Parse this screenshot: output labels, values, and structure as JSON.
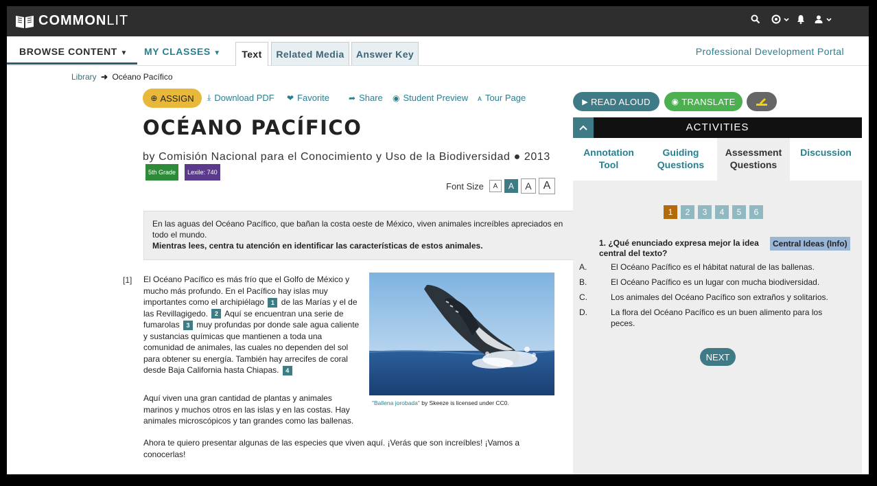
{
  "brand": {
    "part1": "COMMON",
    "part2": "LIT"
  },
  "nav": {
    "browse_content": "BROWSE CONTENT",
    "my_classes": "MY CLASSES",
    "tabs": [
      "Text",
      "Related Media",
      "Answer Key"
    ],
    "pd_portal": "Professional Development Portal"
  },
  "breadcrumb": {
    "library": "Library",
    "current": "Océano Pacífico"
  },
  "actions": {
    "assign": "ASSIGN",
    "download_pdf": "Download PDF",
    "favorite": "Favorite",
    "share": "Share",
    "student_preview": "Student Preview",
    "tour_page": "Tour Page"
  },
  "text": {
    "title": "OCÉANO PACÍFICO",
    "byline": "by Comisión Nacional para el Conocimiento y Uso de la Biodiversidad",
    "year": "2013",
    "grade_badge": "5th Grade",
    "lexile_badge": "Lexile: 740",
    "font_size_label": "Font Size",
    "font_size_options": [
      "A",
      "A",
      "A",
      "A"
    ],
    "intro_line": "En las aguas del Océano Pacífico, que bañan la costa oeste de México, viven animales increíbles apreciados en todo el mundo.",
    "intro_bold": "Mientras lees, centra tu atención en identificar las características de estos animales.",
    "para_number": "[1]",
    "para1_a": "El Océano Pacífico es más frío que el Golfo de México y mucho más profundo. En el Pacífico hay islas muy importantes como el archipiélago",
    "fn1": "1",
    "para1_b": "de las Marías y el de las Revillagigedo.",
    "fn2": "2",
    "para1_c": "Aquí se encuentran una serie de fumarolas",
    "fn3": "3",
    "para1_d": "muy profundas por donde sale agua caliente y sustancias químicas que mantienen a toda una comunidad de animales, las cuales no dependen del sol para obtener su energía. También hay arrecifes de coral desde Baja California hasta Chiapas.",
    "fn4": "4",
    "para2": "Aquí viven una gran cantidad de plantas y animales marinos y muchos otros en las islas y en las costas. Hay animales microscópicos y tan grandes como las ballenas.",
    "para3": "Ahora te quiero presentar algunas de las especies que viven aquí. ¡Verás que son increíbles! ¡Vamos a conocerlas!",
    "caption_link": "\"Ballena jorobada\"",
    "caption_rest": " by Skeeze is licensed under CC0."
  },
  "tools": {
    "read_aloud": "READ ALOUD",
    "translate": "TRANSLATE"
  },
  "activities": {
    "title": "ACTIVITIES",
    "tabs": [
      {
        "line1": "Annotation",
        "line2": "Tool"
      },
      {
        "line1": "Guiding",
        "line2": "Questions"
      },
      {
        "line1": "Assessment",
        "line2": "Questions"
      },
      {
        "line1": "Discussion",
        "line2": ""
      }
    ],
    "question_numbers": [
      "1",
      "2",
      "3",
      "4",
      "5",
      "6"
    ],
    "active_question": "1",
    "question": "1.  ¿Qué enunciado expresa mejor la idea central del texto?",
    "tag": "Central Ideas (Info)",
    "options": [
      {
        "letter": "A.",
        "text": "El Océano Pacífico es el hábitat natural de las ballenas."
      },
      {
        "letter": "B.",
        "text": "El Océano Pacífico es un lugar con mucha biodiversidad."
      },
      {
        "letter": "C.",
        "text": "Los animales del Océano Pacífico son extraños y solitarios."
      },
      {
        "letter": "D.",
        "text": "La flora del Océano Pacífico es un buen alimento para los peces."
      }
    ],
    "next": "NEXT"
  },
  "colors": {
    "accent": "#2a7f8f",
    "assign": "#e7b83a",
    "topbar": "#2e2e2e",
    "translate": "#4caf50",
    "active_q": "#b36a0b"
  }
}
